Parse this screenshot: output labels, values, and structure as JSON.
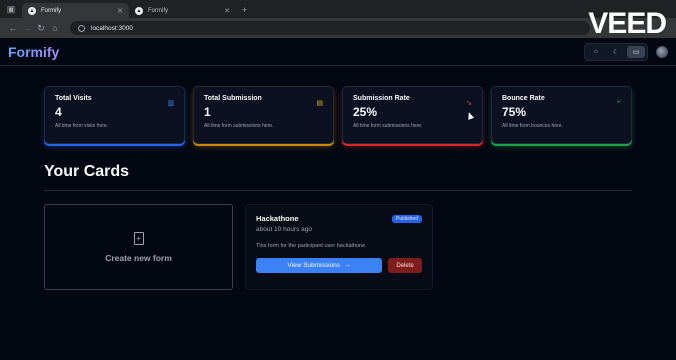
{
  "browser": {
    "tabs": [
      {
        "title": "Formify",
        "active": true
      },
      {
        "title": "Formify",
        "active": false
      }
    ],
    "url": "localhost:3000"
  },
  "app": {
    "logo": "Formify",
    "theme_options": [
      "sun-icon",
      "moon-icon",
      "monitor-icon"
    ]
  },
  "watermark": "VEED",
  "stats": [
    {
      "title": "Total Visits",
      "value": "4",
      "help": "All time form visits here.",
      "icon": "eye-icon",
      "color": "#2563eb"
    },
    {
      "title": "Total Submission",
      "value": "1",
      "help": "All time form submissions here.",
      "icon": "file-icon",
      "color": "#ca8a04"
    },
    {
      "title": "Submission Rate",
      "value": "25%",
      "help": "All time form submissions here.",
      "icon": "pointer-icon",
      "color": "#dc2626"
    },
    {
      "title": "Bounce Rate",
      "value": "75%",
      "help": "All time form bounces here.",
      "icon": "split-icon",
      "color": "#16a34a"
    }
  ],
  "cards_section": {
    "title": "Your Cards",
    "create_label": "Create new form",
    "form": {
      "name": "Hackathone",
      "status": "Published",
      "time": "about 10 hours ago",
      "description": "This form for the participant user hackathone.",
      "view_label": "View Submissions",
      "delete_label": "Delete"
    }
  }
}
